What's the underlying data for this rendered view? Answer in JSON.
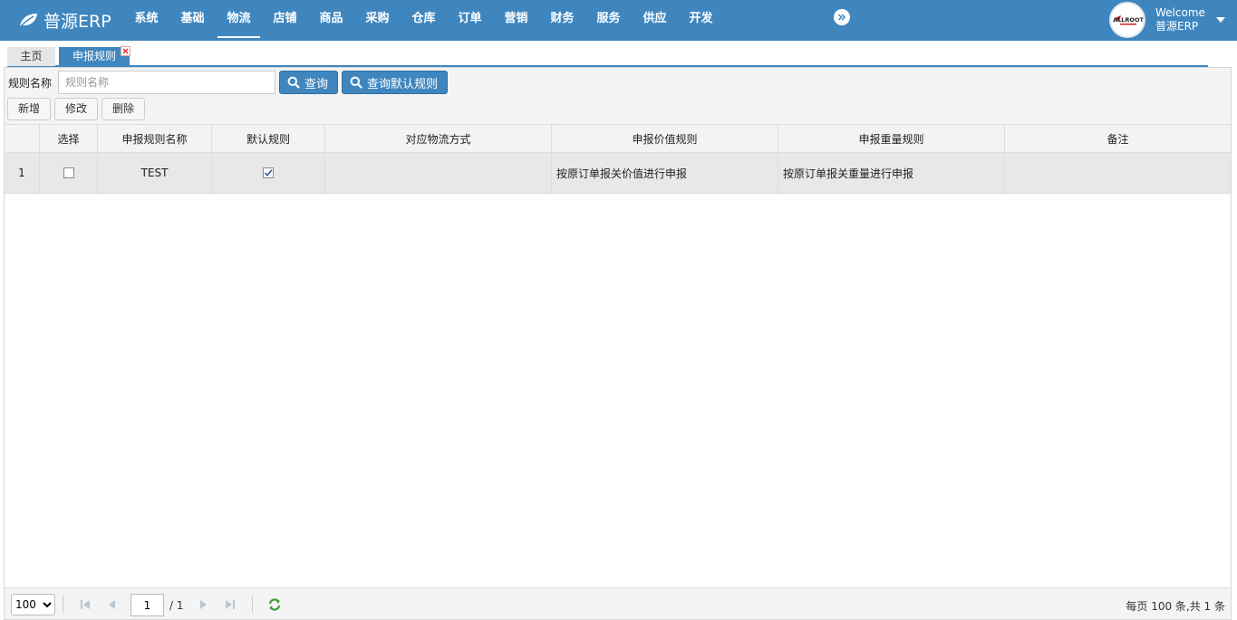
{
  "app": {
    "name": "普源ERP"
  },
  "nav": {
    "items": [
      "系统",
      "基础",
      "物流",
      "店铺",
      "商品",
      "采购",
      "仓库",
      "订单",
      "营销",
      "财务",
      "服务",
      "供应",
      "开发"
    ],
    "active_index": 2
  },
  "user": {
    "welcome": "Welcome",
    "name": "普源ERP",
    "logo_text": "ALLROOT"
  },
  "tabs": {
    "home": "主页",
    "current": "申报规则"
  },
  "search": {
    "label": "规则名称",
    "placeholder": "规则名称",
    "query_button": "查询",
    "default_button": "查询默认规则"
  },
  "toolbar": {
    "add": "新增",
    "edit": "修改",
    "delete": "删除"
  },
  "table": {
    "columns": [
      "",
      "选择",
      "申报规则名称",
      "默认规则",
      "对应物流方式",
      "申报价值规则",
      "申报重量规则",
      "备注"
    ],
    "rows": [
      {
        "index": "1",
        "selected": false,
        "name": "TEST",
        "is_default": true,
        "logistics": "",
        "value_rule": "按原订单报关价值进行申报",
        "weight_rule": "按原订单报关重量进行申报",
        "note": ""
      }
    ]
  },
  "pager": {
    "page_size": "100",
    "current_page": "1",
    "total_pages": "/ 1",
    "info": "每页 100 条,共 1 条"
  },
  "colors": {
    "brand": "#3f86bf",
    "row_bg": "#e8e8e8"
  }
}
